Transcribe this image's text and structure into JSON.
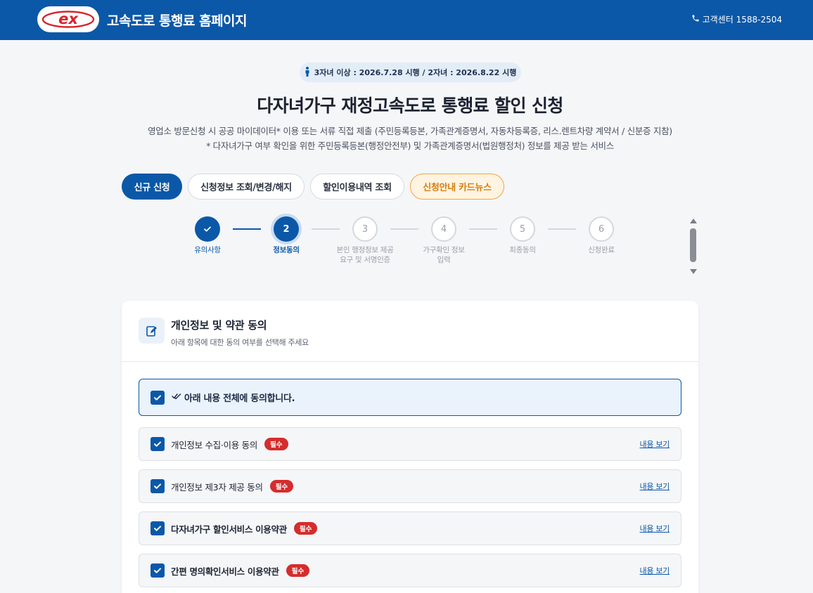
{
  "header": {
    "site_title": "고속도로 통행료 홈페이지",
    "customer_center": "고객센터 1588-2504",
    "logo_text": "ex"
  },
  "notice": {
    "date_pill": "3자녀 이상 : 2026.7.28 시행 / 2자녀 : 2026.8.22 시행"
  },
  "page": {
    "title": "다자녀가구 재정고속도로 통행료 할인 신청",
    "desc_line1": "영업소 방문신청 시 공공 마이데이터* 이용 또는 서류 직접 제출 (주민등록등본, 가족관계증명서, 자동차등록증, 리스.렌트차량 계약서 / 신분증 지참)",
    "desc_line2": "* 다자녀가구 여부 확인을 위한 주민등록등본(행정안전부) 및 가족관계증명서(법원행정처) 정보를 제공 받는 서비스"
  },
  "tabs": [
    {
      "label": "신규 신청"
    },
    {
      "label": "신청정보 조회/변경/해지"
    },
    {
      "label": "할인이용내역 조회"
    },
    {
      "label": "신청안내 카드뉴스"
    }
  ],
  "steps": [
    {
      "num": "✓",
      "label": "유의사항",
      "state": "done"
    },
    {
      "num": "2",
      "label": "정보동의",
      "state": "active"
    },
    {
      "num": "3",
      "label": "본인 행정정보 제공 요구 및 서명인증",
      "state": "todo"
    },
    {
      "num": "4",
      "label": "가구확인 정보입력",
      "state": "todo"
    },
    {
      "num": "5",
      "label": "최종동의",
      "state": "todo"
    },
    {
      "num": "6",
      "label": "신청완료",
      "state": "todo"
    }
  ],
  "consent": {
    "title": "개인정보 및 약관 동의",
    "subtitle": "아래 항목에 대한 동의 여부를 선택해 주세요",
    "all_label": "아래 내용 전체에 동의합니다.",
    "required_badge": "필수",
    "view_label": "내용 보기",
    "items": [
      {
        "label": "개인정보 수집·이용 동의"
      },
      {
        "label": "개인정보 제3자 제공 동의"
      },
      {
        "label": "다자녀가구 할인서비스 이용약관"
      },
      {
        "label": "간편 명의확인서비스 이용약관"
      }
    ]
  },
  "colors": {
    "brand": "#0b58a8",
    "required": "#d42d2d",
    "news_accent": "#d77d0e"
  }
}
